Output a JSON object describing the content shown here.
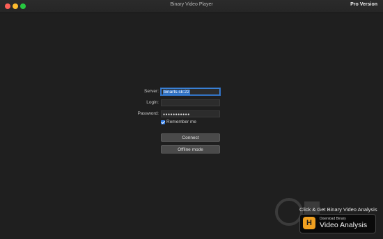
{
  "window": {
    "title": "Binary Video Player",
    "pro_label": "Pro Version"
  },
  "form": {
    "server_label": "Server:",
    "server_value": "binarts.sk:22",
    "login_label": "Login:",
    "login_value": "",
    "password_label": "Password:",
    "password_value": "●●●●●●●●●●●",
    "remember_label": "Remember me",
    "remember_checked": true
  },
  "buttons": {
    "connect": "Connect",
    "offline": "Offline mode"
  },
  "promo": {
    "headline": "Click & Get Binary Video Analysis",
    "badge_small": "Download Binary",
    "badge_big": "Video Analysis"
  },
  "colors": {
    "background": "#1f1f1f",
    "accent": "#2f7be5",
    "badge_orange": "#f0a020"
  }
}
